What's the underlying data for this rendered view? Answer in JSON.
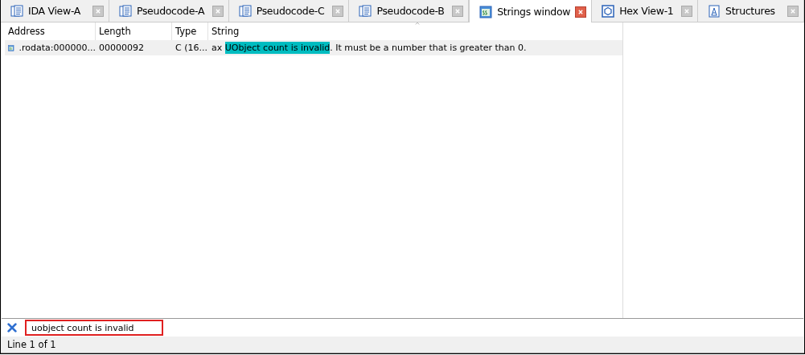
{
  "tabs": [
    {
      "label": "IDA View-A",
      "kind": "listing",
      "selected": false
    },
    {
      "label": "Pseudocode-A",
      "kind": "listing",
      "selected": false
    },
    {
      "label": "Pseudocode-C",
      "kind": "listing",
      "selected": false
    },
    {
      "label": "Pseudocode-B",
      "kind": "listing",
      "selected": false
    },
    {
      "label": "Strings window",
      "kind": "strings",
      "selected": true
    },
    {
      "label": "Hex View-1",
      "kind": "hex",
      "selected": false
    },
    {
      "label": "Structures",
      "kind": "struct",
      "selected": false
    }
  ],
  "table": {
    "columns": [
      "Address",
      "Length",
      "Type",
      "String"
    ],
    "rows": [
      {
        "address": ".rodata:000000...",
        "length": "00000092",
        "type": "C (16...",
        "string_prefix": "ax ",
        "string_match": "UObject count is invalid",
        "string_suffix": ". It must be a number that is greater than 0.",
        "selected": true
      }
    ]
  },
  "search": {
    "value": "uobject count is invalid"
  },
  "status_bar": "Line 1 of 1"
}
